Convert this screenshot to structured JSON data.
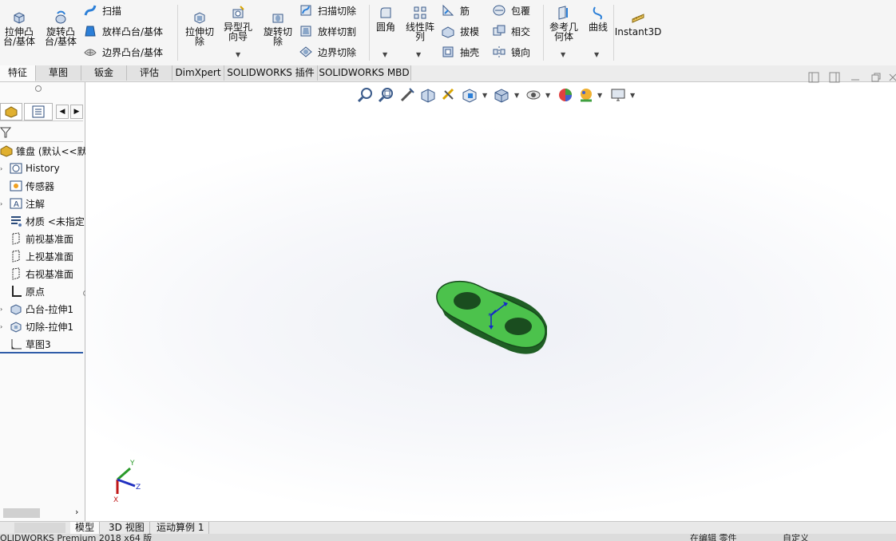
{
  "ribbon": {
    "extrude_boss": "拉伸凸台/基体",
    "revolve_boss": "旋转凸台/基体",
    "sweep": "扫描",
    "loft_boss": "放样凸台/基体",
    "boundary_boss": "边界凸台/基体",
    "extrude_cut": "拉伸切除",
    "hole_wizard": "异型孔向导",
    "revolve_cut": "旋转切除",
    "sweep_cut": "扫描切除",
    "loft_cut": "放样切割",
    "boundary_cut": "边界切除",
    "fillet": "圆角",
    "linear_pattern": "线性阵列",
    "rib": "筋",
    "draft": "拔模",
    "shell": "抽壳",
    "wrap": "包覆",
    "intersect": "相交",
    "mirror": "镜向",
    "ref_geometry": "参考几何体",
    "curves": "曲线",
    "instant3d": "Instant3D"
  },
  "tabs": [
    "特征",
    "草图",
    "钣金",
    "评估",
    "DimXpert",
    "SOLIDWORKS 插件",
    "SOLIDWORKS MBD"
  ],
  "tree": {
    "root": "锥盘 (默认<<默",
    "items": [
      "History",
      "传感器",
      "注解",
      "材质 <未指定",
      "前视基准面",
      "上视基准面",
      "右视基准面",
      "原点",
      "凸台-拉伸1",
      "切除-拉伸1",
      "草图3"
    ]
  },
  "axes": {
    "x": "X",
    "y": "Y",
    "z": "Z"
  },
  "bottom_tabs": [
    "模型",
    "3D 视图",
    "运动算例 1"
  ],
  "status": {
    "left": "OLIDWORKS Premium 2018 x64 版",
    "mid": "在编辑 零件",
    "right": "自定义"
  },
  "colors": {
    "part_green": "#4cc24c",
    "part_dark": "#1f5e24",
    "tab_active": "#fafafa"
  }
}
